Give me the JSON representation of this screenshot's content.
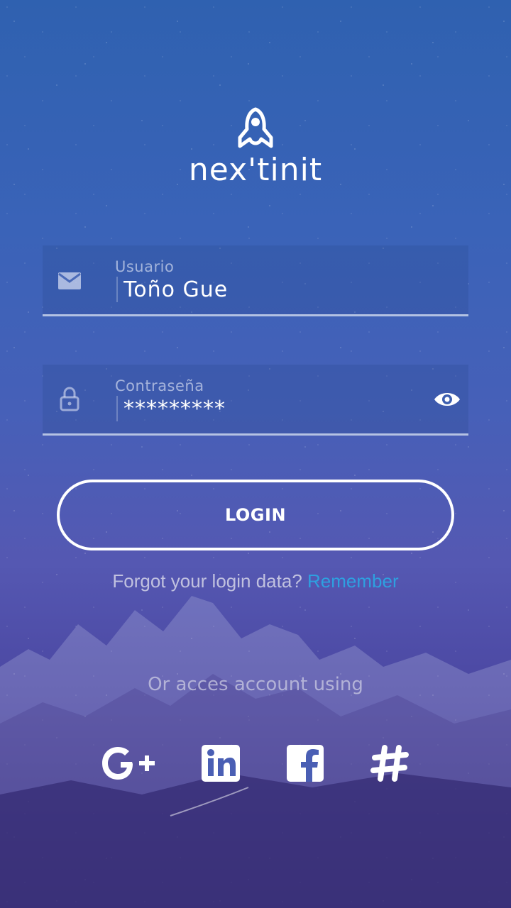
{
  "app": {
    "logo_text": "nex'tinit"
  },
  "form": {
    "user": {
      "label": "Usuario",
      "value": "Toño Gue"
    },
    "password": {
      "label": "Contraseña",
      "value": "*********"
    },
    "login_label": "LOGIN"
  },
  "forgot": {
    "text": "Forgot your login data?",
    "link": "Remember"
  },
  "social": {
    "heading": "Or acces account using",
    "items": [
      "google-plus-icon",
      "linkedin-icon",
      "facebook-icon",
      "slack-icon"
    ]
  },
  "colors": {
    "accent_link": "#2ea0e0",
    "text": "#ffffff"
  }
}
